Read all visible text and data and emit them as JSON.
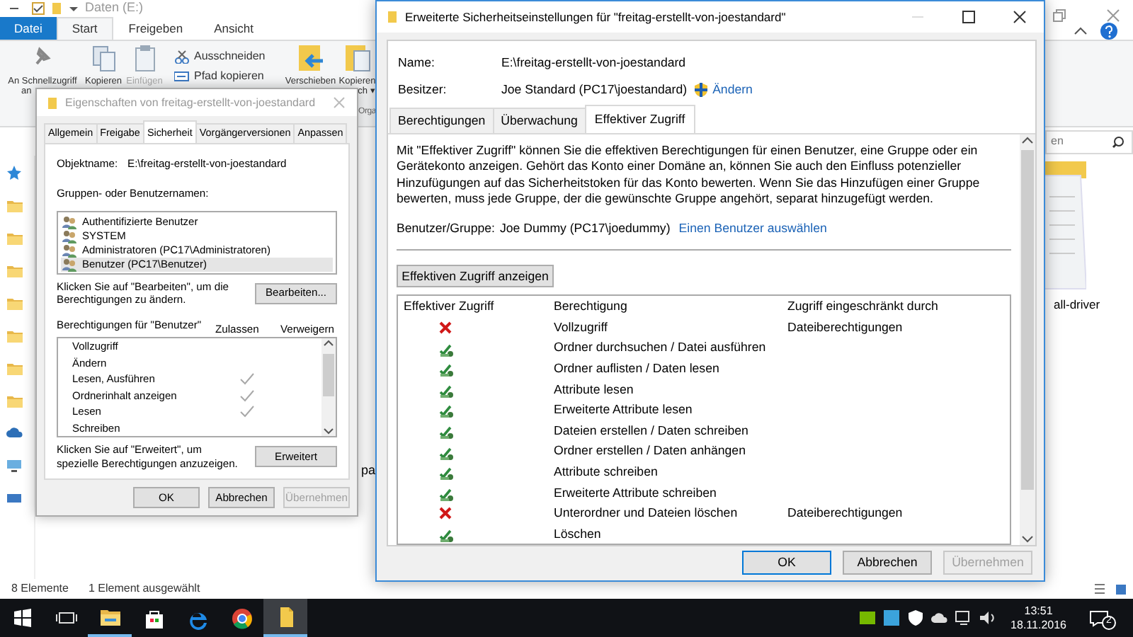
{
  "explorer": {
    "title": "Daten (E:)",
    "ribbon_tabs": [
      {
        "label": "Datei",
        "kind": "file",
        "selected": false
      },
      {
        "label": "Start",
        "kind": "tab",
        "selected": true
      },
      {
        "label": "Freigeben",
        "kind": "tab",
        "selected": false
      },
      {
        "label": "Ansicht",
        "kind": "tab",
        "selected": false
      }
    ],
    "ribbon_items": [
      {
        "kind": "pin",
        "label": "An Schnellzugriff",
        "label_2": "an",
        "disabled": false
      },
      {
        "kind": "copy",
        "label": "Kopieren",
        "disabled": false
      },
      {
        "kind": "paste",
        "label": "Einfügen",
        "disabled": true
      },
      {
        "kind": "small",
        "items": [
          {
            "kind": "cut",
            "label": "Ausschneiden"
          },
          {
            "kind": "path",
            "label": "Pfad kopieren"
          }
        ]
      },
      {
        "kind": "move",
        "label": "Verschieben",
        "disabled": false
      },
      {
        "kind": "copyto",
        "label": "Kopieren",
        "label_2": "ch ▾",
        "disabled": false
      }
    ],
    "ribbon_group": "Orga",
    "search": {
      "placeholder": "en"
    },
    "files": [
      {
        "name": "pa",
        "kind": "text"
      },
      {
        "name": "all-driver",
        "kind": "document"
      }
    ],
    "status": [
      "8 Elemente",
      "1 Element ausgewählt"
    ]
  },
  "properties_dialog": {
    "title": "Eigenschaften von freitag-erstellt-von-joestandard",
    "active": false,
    "tabs": [
      {
        "label": "Allgemein",
        "selected": false
      },
      {
        "label": "Freigabe",
        "selected": false
      },
      {
        "label": "Sicherheit",
        "selected": true
      },
      {
        "label": "Vorgängerversionen",
        "selected": false
      },
      {
        "label": "Anpassen",
        "selected": false
      }
    ],
    "object_label": "Objektname:",
    "object_value": "E:\\freitag-erstellt-von-joestandard",
    "groups_label": "Gruppen- oder Benutzernamen:",
    "groups": [
      {
        "name": "Authentifizierte Benutzer",
        "selected": false
      },
      {
        "name": "SYSTEM",
        "selected": false
      },
      {
        "name": "Administratoren (PC17\\Administratoren)",
        "selected": false
      },
      {
        "name": "Benutzer (PC17\\Benutzer)",
        "selected": true
      }
    ],
    "edit_hint": "Klicken Sie auf \"Bearbeiten\", um die Berechtigungen zu ändern.",
    "edit_button": "Bearbeiten...",
    "permissions_label": "Berechtigungen für \"Benutzer\"",
    "allow_header": "Zulassen",
    "deny_header": "Verweigern",
    "permissions": [
      {
        "name": "Vollzugriff",
        "allow": false,
        "deny": false
      },
      {
        "name": "Ändern",
        "allow": false,
        "deny": false
      },
      {
        "name": "Lesen, Ausführen",
        "allow": true,
        "deny": false
      },
      {
        "name": "Ordnerinhalt anzeigen",
        "allow": true,
        "deny": false
      },
      {
        "name": "Lesen",
        "allow": true,
        "deny": false
      },
      {
        "name": "Schreiben",
        "allow": false,
        "deny": false
      }
    ],
    "advanced_hint": "Klicken Sie auf \"Erweitert\", um spezielle Berechtigungen anzuzeigen.",
    "advanced_button": "Erweitert",
    "buttons": [
      {
        "label": "OK",
        "disabled": false
      },
      {
        "label": "Abbrechen",
        "disabled": false
      },
      {
        "label": "Übernehmen",
        "disabled": true
      }
    ]
  },
  "advanced_dialog": {
    "title": "Erweiterte Sicherheitseinstellungen für \"freitag-erstellt-von-joestandard\"",
    "active": true,
    "name_label": "Name:",
    "name_value": "E:\\freitag-erstellt-von-joestandard",
    "owner_label": "Besitzer:",
    "owner_value": "Joe Standard (PC17\\joestandard)",
    "owner_link": "Ändern",
    "tabs": [
      {
        "label": "Berechtigungen",
        "selected": false
      },
      {
        "label": "Überwachung",
        "selected": false
      },
      {
        "label": "Effektiver Zugriff",
        "selected": true
      }
    ],
    "description": "Mit \"Effektiver Zugriff\" können Sie die effektiven Berechtigungen für einen Benutzer, eine Gruppe oder ein Gerätekonto anzeigen. Gehört das Konto einer Domäne an, können Sie auch den Einfluss potenzieller Hinzufügungen auf das Sicherheitstoken für das Konto bewerten. Wenn Sie das Hinzufügen einer Gruppe bewerten, muss jede Gruppe, der die gewünschte Gruppe angehört, separat hinzugefügt werden.",
    "user_label": "Benutzer/Gruppe:",
    "user_value": "Joe Dummy (PC17\\joedummy)",
    "user_link": "Einen Benutzer auswählen",
    "show_button": "Effektiven Zugriff anzeigen",
    "table": {
      "columns": [
        "Effektiver Zugriff",
        "Berechtigung",
        "Zugriff eingeschränkt durch"
      ],
      "rows": [
        {
          "allowed": false,
          "permission": "Vollzugriff",
          "limited_by": "Dateiberechtigungen"
        },
        {
          "allowed": true,
          "permission": "Ordner durchsuchen / Datei ausführen"
        },
        {
          "allowed": true,
          "permission": "Ordner auflisten / Daten lesen"
        },
        {
          "allowed": true,
          "permission": "Attribute lesen"
        },
        {
          "allowed": true,
          "permission": "Erweiterte Attribute lesen"
        },
        {
          "allowed": true,
          "permission": "Dateien erstellen / Daten schreiben"
        },
        {
          "allowed": true,
          "permission": "Ordner erstellen / Daten anhängen"
        },
        {
          "allowed": true,
          "permission": "Attribute schreiben"
        },
        {
          "allowed": true,
          "permission": "Erweiterte Attribute schreiben"
        },
        {
          "allowed": false,
          "permission": "Unterordner und Dateien löschen",
          "limited_by": "Dateiberechtigungen"
        },
        {
          "allowed": true,
          "permission": "Löschen"
        }
      ]
    },
    "buttons": [
      {
        "label": "OK",
        "disabled": false,
        "default": true
      },
      {
        "label": "Abbrechen",
        "disabled": false,
        "default": false
      },
      {
        "label": "Übernehmen",
        "disabled": true,
        "default": false
      }
    ]
  },
  "taskbar": {
    "apps": [
      {
        "kind": "start",
        "running": false,
        "selected": false
      },
      {
        "kind": "taskview",
        "running": false,
        "selected": false
      },
      {
        "kind": "explorer",
        "running": true,
        "selected": false
      },
      {
        "kind": "store",
        "running": false,
        "selected": false
      },
      {
        "kind": "edge",
        "running": false,
        "selected": false
      },
      {
        "kind": "chrome",
        "running": false,
        "selected": false
      },
      {
        "kind": "folder",
        "running": true,
        "selected": true
      }
    ],
    "time": "13:51",
    "date": "18.11.2016",
    "notifications": "2"
  }
}
